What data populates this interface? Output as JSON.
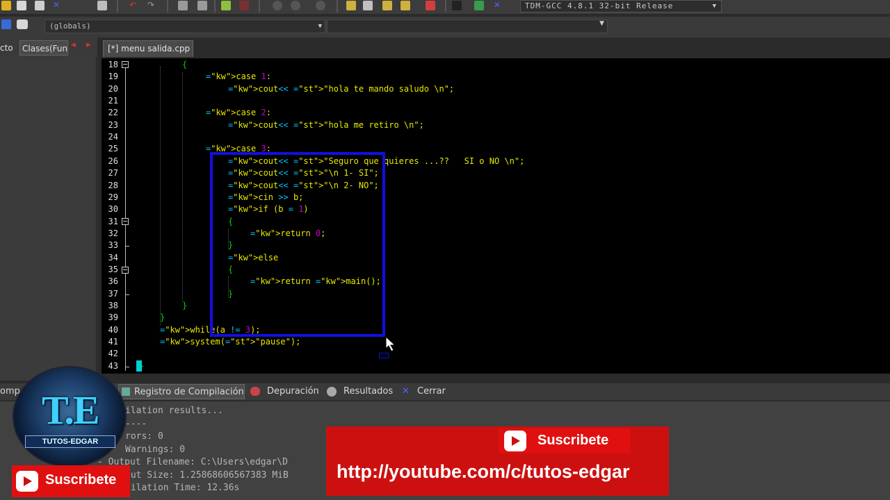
{
  "toolbar": {
    "compiler": "TDM-GCC 4.8.1 32-bit Release"
  },
  "scope": {
    "globals": "(globals)"
  },
  "left_tabs": [
    "cto",
    "Clases(Fun"
  ],
  "file_tab": "[*] menu salida.cpp",
  "editor": {
    "lines": [
      {
        "n": "18",
        "code": "{"
      },
      {
        "n": "19",
        "code": "case 1:"
      },
      {
        "n": "20",
        "code": "cout<< \"hola te mando saludo \\n\";"
      },
      {
        "n": "21",
        "code": ""
      },
      {
        "n": "22",
        "code": "case 2:"
      },
      {
        "n": "23",
        "code": "cout<< \"hola me retiro \\n\";"
      },
      {
        "n": "24",
        "code": ""
      },
      {
        "n": "25",
        "code": "case 3:"
      },
      {
        "n": "26",
        "code": "cout<< \"Seguro que quieres ...??   SI o NO \\n\";"
      },
      {
        "n": "27",
        "code": "cout<< \"\\n 1- SI\";"
      },
      {
        "n": "28",
        "code": "cout<< \"\\n 2- NO\";"
      },
      {
        "n": "29",
        "code": "cin >> b;"
      },
      {
        "n": "30",
        "code": "if (b = 1)"
      },
      {
        "n": "31",
        "code": "{"
      },
      {
        "n": "32",
        "code": "return 0;"
      },
      {
        "n": "33",
        "code": "}"
      },
      {
        "n": "34",
        "code": "else"
      },
      {
        "n": "35",
        "code": "{"
      },
      {
        "n": "36",
        "code": "return main();"
      },
      {
        "n": "37",
        "code": "}"
      },
      {
        "n": "38",
        "code": "}"
      },
      {
        "n": "39",
        "code": "}"
      },
      {
        "n": "40",
        "code": "while(a != 3);"
      },
      {
        "n": "41",
        "code": "system(\"pause\");"
      },
      {
        "n": "42",
        "code": ""
      },
      {
        "n": "43",
        "code": "}"
      }
    ]
  },
  "bottom_tabs": {
    "left": "omp",
    "log": "Registro de Compilación",
    "debug": "Depuración",
    "results": "Resultados",
    "close": "Cerrar"
  },
  "log_lines": [
    "ilation results...",
    "----",
    "rors: 0",
    "Warnings: 0",
    "- Output Filename: C:\\Users\\edgar\\D",
    "put Size: 1.25868606567383 MiB",
    "pilation Time: 12.36s"
  ],
  "overlay": {
    "subscribe": "Suscribete",
    "url": "http://youtube.com/c/tutos-edgar",
    "logo_letters": "T.E",
    "logo_name": "TUTOS-EDGAR"
  },
  "colors": {
    "selection_box": "#1010e0",
    "banner": "#cc1010",
    "editor_bg": "#000000"
  }
}
